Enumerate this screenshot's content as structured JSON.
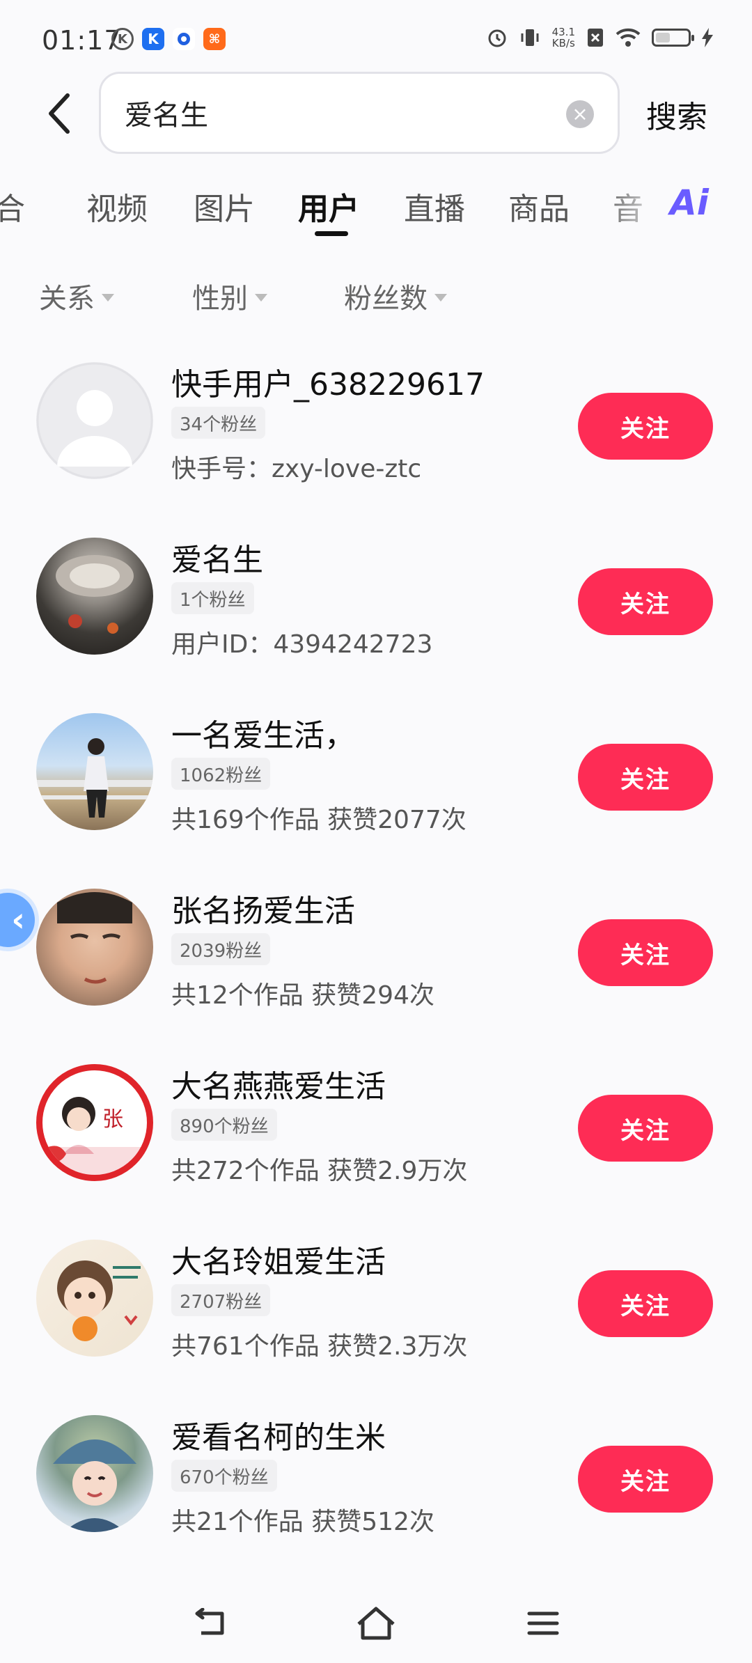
{
  "status_bar": {
    "time": "01:17",
    "net_speed_value": "43.1",
    "net_speed_unit": "KB/s",
    "left_icons": [
      "k-app-icon",
      "k-blue-icon",
      "circle-app-icon",
      "orange-app-icon"
    ],
    "right_icons": [
      "alarm-icon",
      "vibrate-icon",
      "no-sim-icon",
      "wifi-icon",
      "battery-icon",
      "charging-icon"
    ]
  },
  "search": {
    "query": "爱名生",
    "submit_label": "搜索"
  },
  "tabs": [
    {
      "label": "合"
    },
    {
      "label": "视频"
    },
    {
      "label": "图片"
    },
    {
      "label": "用户"
    },
    {
      "label": "直播"
    },
    {
      "label": "商品"
    },
    {
      "label": "音"
    }
  ],
  "active_tab": "用户",
  "ai_label": "Ai",
  "filters": [
    {
      "label": "关系"
    },
    {
      "label": "性别"
    },
    {
      "label": "粉丝数"
    }
  ],
  "users": [
    {
      "name": "快手用户_638229617",
      "fans": "34个粉丝",
      "meta": "快手号：zxy-love-ztc",
      "follow": "关注",
      "avatar": "default-avatar"
    },
    {
      "name": "爱名生",
      "fans": "1个粉丝",
      "meta": "用户ID：4394242723",
      "follow": "关注",
      "avatar": "photo-avatar"
    },
    {
      "name": "一名爱生活，",
      "fans": "1062粉丝",
      "meta": "共169个作品 获赞2077次",
      "follow": "关注",
      "avatar": "photo-avatar"
    },
    {
      "name": "张名扬爱生活",
      "fans": "2039粉丝",
      "meta": "共12个作品 获赞294次",
      "follow": "关注",
      "avatar": "photo-avatar"
    },
    {
      "name": "大名燕燕爱生活",
      "fans": "890个粉丝",
      "meta": "共272个作品 获赞2.9万次",
      "follow": "关注",
      "avatar": "illustration-avatar"
    },
    {
      "name": "大名玲姐爱生活",
      "fans": "2707粉丝",
      "meta": "共761个作品 获赞2.3万次",
      "follow": "关注",
      "avatar": "illustration-avatar"
    },
    {
      "name": "爱看名柯的生米",
      "fans": "670个粉丝",
      "meta": "共21个作品 获赞512次",
      "follow": "关注",
      "avatar": "photo-avatar"
    }
  ],
  "colors": {
    "follow_button": "#fe2c55",
    "background": "#fafafc",
    "badge_bg": "#f0f0f2",
    "ai_accent": "#6a5cff"
  }
}
